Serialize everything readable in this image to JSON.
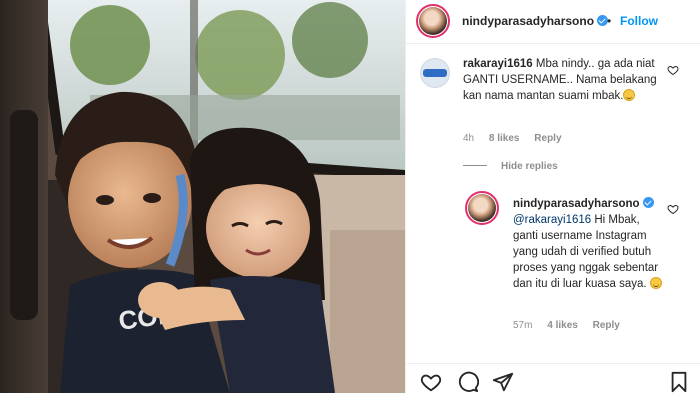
{
  "header": {
    "username": "nindyparasadyharsono",
    "separator": "•",
    "follow_label": "Follow"
  },
  "comments": [
    {
      "username": "rakarayi1616",
      "text": "Mba nindy.. ga ada niat GANTI USERNAME.. Nama belakang kan nama mantan suami mbak.",
      "emoji": "smiling-face-icon",
      "time": "4h",
      "likes": "8 likes",
      "reply_label": "Reply"
    },
    {
      "username": "nindyparasadyharsono",
      "mention": "@rakarayi1616",
      "text": "Hi Mbak, ganti username Instagram yang udah di verified butuh proses yang nggak sebentar dan itu di luar kuasa saya.",
      "emoji": "smiling-face-icon",
      "time": "57m",
      "likes": "4 likes",
      "reply_label": "Reply"
    }
  ],
  "hide_replies_label": "Hide replies",
  "colors": {
    "link_blue": "#0095f6",
    "verified_blue": "#3897f0",
    "meta_gray": "#8e8e8e",
    "text": "#262626"
  },
  "icons": {
    "actions": [
      "heart-icon",
      "comment-icon",
      "share-icon",
      "bookmark-icon"
    ]
  }
}
